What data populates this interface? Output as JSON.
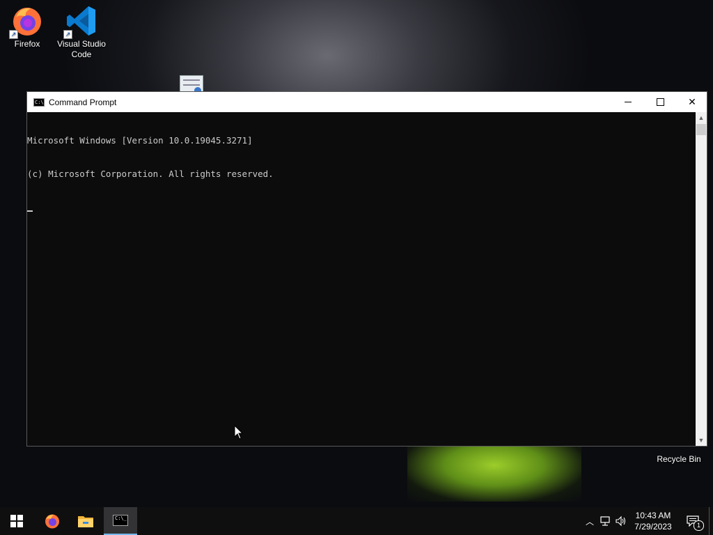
{
  "desktop": {
    "icons": [
      {
        "label": "Firefox"
      },
      {
        "label": "Visual Studio Code"
      },
      {
        "label": "Recycle Bin"
      }
    ]
  },
  "window": {
    "title": "Command Prompt",
    "minimize_glyph": "—",
    "maximize_glyph": "☐",
    "close_glyph": "✕",
    "console_lines": [
      "Microsoft Windows [Version 10.0.19045.3271]",
      "(c) Microsoft Corporation. All rights reserved."
    ]
  },
  "taskbar": {
    "apps": [
      "start-icon",
      "firefox-icon",
      "file-explorer-icon",
      "command-prompt-icon"
    ],
    "tray": {
      "time": "10:43 AM",
      "date": "7/29/2023",
      "notification_count": "1"
    }
  },
  "colors": {
    "console_bg": "#0c0c0c",
    "console_text": "#cccccc",
    "taskbar_bg": "#0f0f10",
    "accent": "#76b9ed"
  }
}
